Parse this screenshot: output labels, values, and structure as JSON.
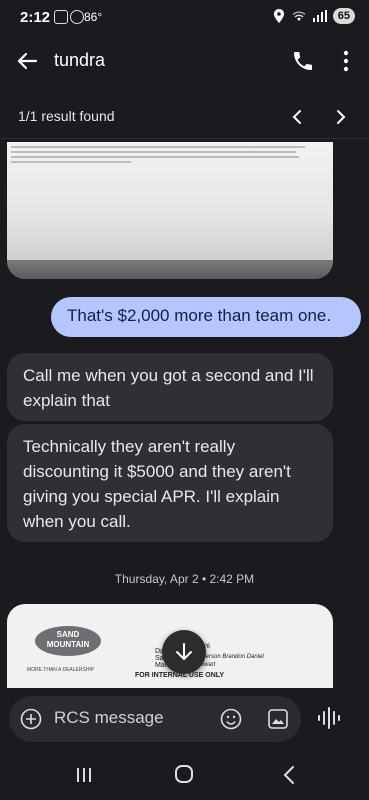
{
  "status_bar": {
    "time": "2:12",
    "temperature": "86°",
    "battery": "65"
  },
  "app_bar": {
    "title": "tundra"
  },
  "search": {
    "result_text": "1/1 result found"
  },
  "messages": [
    {
      "direction": "outgoing",
      "text": "That's $2,000 more than team one."
    },
    {
      "direction": "incoming",
      "text": "Call me when you got a second and I'll explain that"
    },
    {
      "direction": "incoming",
      "text": "Technically they aren't really discounting it $5000 and they aren't giving you special APR. I'll explain when you call."
    }
  ],
  "date_label": "Thursday, Apr 2 • 2:42 PM",
  "attachment_2": {
    "logo_line1": "SAND",
    "logo_line2": "MOUNTAIN",
    "logo_tagline": "MORE THAN A DEALERSHIP",
    "field_date": "Dat",
    "field_sales": "Sal",
    "field_manager": "Man",
    "date_value": "/2026",
    "sales_value": "Epperson Brandon Daniel",
    "manager_value": "Stewart",
    "footer": "FOR INTERNAL USE ONLY"
  },
  "composer": {
    "placeholder": "RCS message"
  },
  "colors": {
    "background": "#1b1b1f",
    "outgoing_bubble": "#b6c4ff",
    "incoming_bubble": "#2f3035"
  },
  "icons": [
    "back-arrow-icon",
    "phone-icon",
    "more-vert-icon",
    "chevron-left-icon",
    "chevron-right-icon",
    "add-icon",
    "emoji-icon",
    "gallery-icon",
    "voice-icon",
    "arrow-down-icon"
  ]
}
